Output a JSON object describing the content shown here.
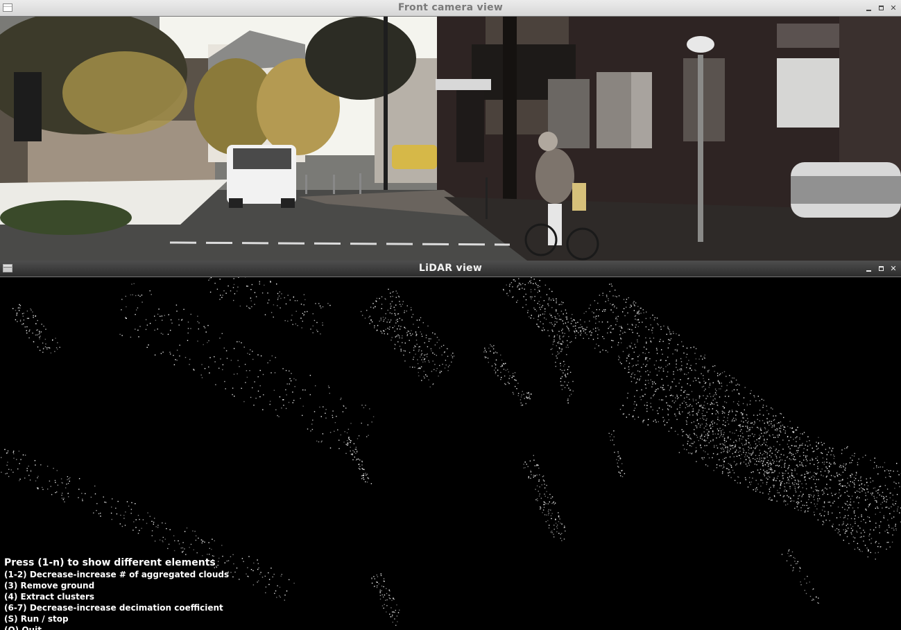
{
  "windows": {
    "camera": {
      "title": "Front camera view"
    },
    "lidar": {
      "title": "LiDAR view"
    }
  },
  "icons": {
    "app": "app-window-icon",
    "minimize": "minimize-icon",
    "maximize": "maximize-icon",
    "close": "close-icon"
  },
  "help": {
    "heading": "Press (1-n) to show different elements",
    "lines": [
      "(1-2) Decrease-increase # of aggregated clouds",
      "(3) Remove ground",
      "(4) Extract clusters",
      "(6-7) Decrease-increase decimation coefficient",
      "(S) Run / stop",
      "(Q) Quit"
    ]
  },
  "colors": {
    "lidar_bg": "#000000",
    "points": "#ffffff",
    "text": "#ffffff"
  }
}
